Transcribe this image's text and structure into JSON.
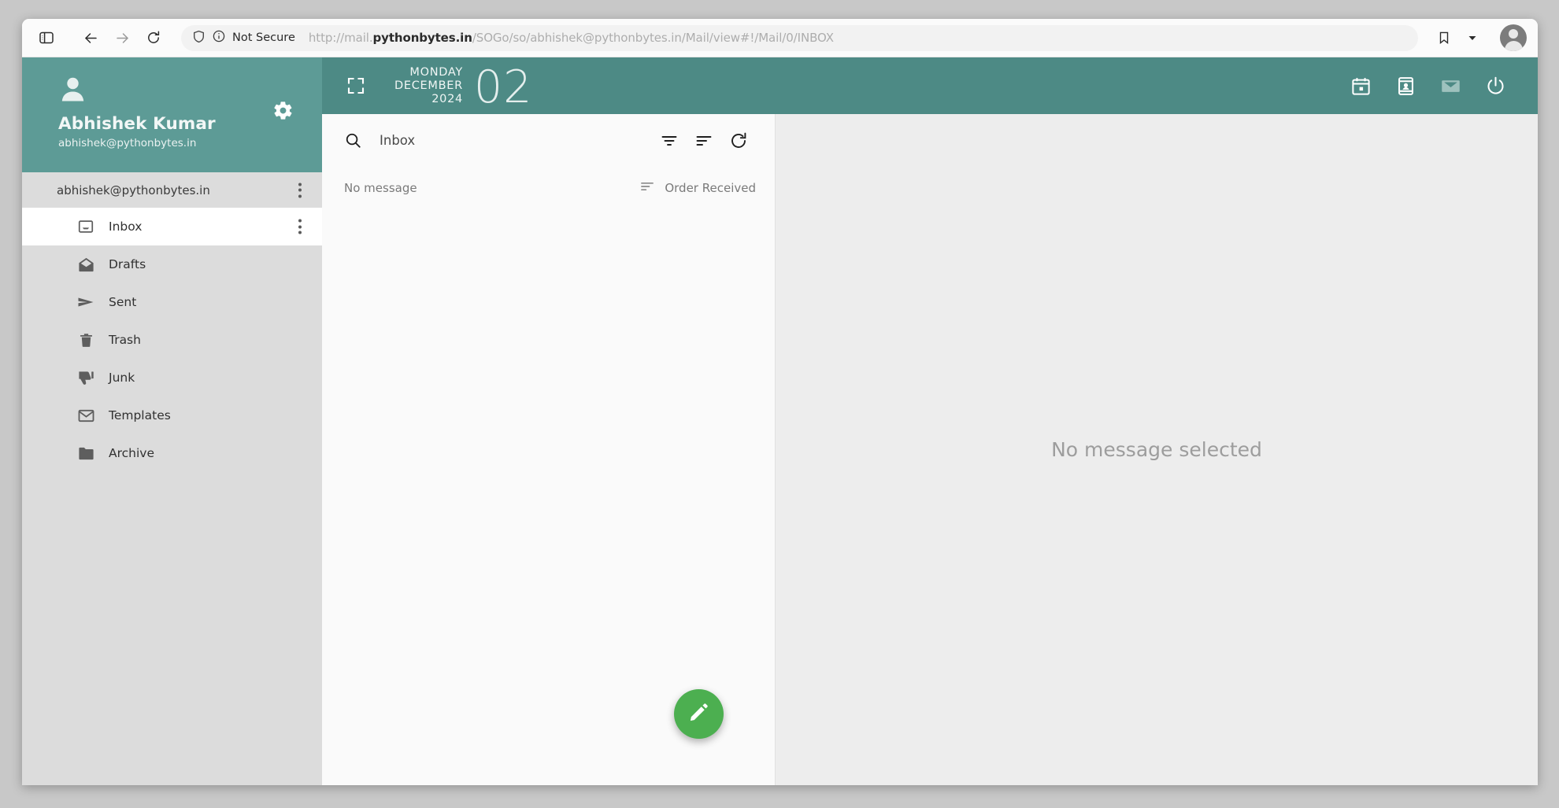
{
  "browser": {
    "security_label": "Not Secure",
    "url_prefix": "http://mail.",
    "url_domain": "pythonbytes.in",
    "url_path": "/SOGo/so/abhishek@pythonbytes.in/Mail/view#!/Mail/0/INBOX",
    "full_url": "http://mail.pythonbytes.in/SOGo/so/abhishek@pythonbytes.in/Mail/view#!/Mail/0/INBOX",
    "icons": {
      "sidebar_toggle": "sidebar-toggle-icon",
      "back": "back-arrow-icon",
      "forward": "forward-arrow-icon",
      "reload": "reload-icon",
      "shield": "shield-icon",
      "info": "info-circle-icon",
      "bookmark": "bookmark-icon",
      "chevron": "chevron-down-icon",
      "profile": "profile-avatar-icon"
    }
  },
  "sidebar": {
    "user_name": "Abhishek Kumar",
    "user_email": "abhishek@pythonbytes.in",
    "account_label": "abhishek@pythonbytes.in",
    "gear_icon": "gear-icon",
    "folders": [
      {
        "label": "Inbox",
        "icon": "inbox-icon",
        "active": true
      },
      {
        "label": "Drafts",
        "icon": "drafts-icon",
        "active": false
      },
      {
        "label": "Sent",
        "icon": "sent-icon",
        "active": false
      },
      {
        "label": "Trash",
        "icon": "trash-icon",
        "active": false
      },
      {
        "label": "Junk",
        "icon": "junk-icon",
        "active": false
      },
      {
        "label": "Templates",
        "icon": "templates-icon",
        "active": false
      },
      {
        "label": "Archive",
        "icon": "archive-icon",
        "active": false
      }
    ]
  },
  "topbar": {
    "weekday": "MONDAY",
    "month": "DECEMBER",
    "year": "2024",
    "day_number": "02",
    "expand_icon": "fullscreen-icon",
    "modules": [
      {
        "name": "calendar-module-icon",
        "active": false
      },
      {
        "name": "contacts-module-icon",
        "active": false
      },
      {
        "name": "mail-module-icon",
        "active": true
      },
      {
        "name": "logout-icon",
        "active": false
      }
    ]
  },
  "maillist": {
    "search_placeholder": "Inbox",
    "search_value": "",
    "search_icon": "search-icon",
    "filter_icon": "filter-icon",
    "sort_icon": "sort-icon",
    "refresh_icon": "refresh-icon",
    "empty_label": "No message",
    "order_label": "Order Received",
    "order_icon": "sort-lines-icon",
    "compose_icon": "pencil-icon"
  },
  "readpane": {
    "empty_message": "No message selected"
  },
  "colors": {
    "teal_sidebar": "#5d9b96",
    "teal_toolbar": "#4d8a85",
    "accent_green": "#4caf50",
    "sidebar_bg": "#dcdcdc",
    "readpane_bg": "#ededed"
  }
}
